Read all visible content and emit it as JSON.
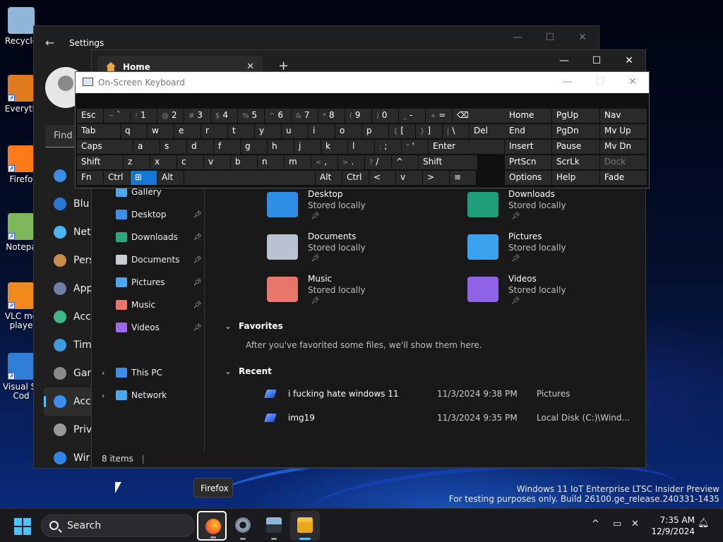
{
  "desktop": {
    "icons": [
      {
        "label": "Recycle"
      },
      {
        "label": "Everyth"
      },
      {
        "label": "Firefo"
      },
      {
        "label": "Notepa"
      },
      {
        "label": "VLC me\nplaye"
      },
      {
        "label": "Visual St\nCod"
      }
    ],
    "watermark_line1": "Windows 11 IoT Enterprise LTSC Insider Preview",
    "watermark_line2": "For testing purposes only. Build 26100.ge_release.240331-1435"
  },
  "settings": {
    "title": "Settings",
    "find_placeholder": "Find a",
    "nav": [
      {
        "label": "",
        "color": "#3a8ee6"
      },
      {
        "label": "Blu",
        "color": "#2a78d6"
      },
      {
        "label": "Net",
        "color": "#4cb4f0"
      },
      {
        "label": "Pers",
        "color": "#c98a4a"
      },
      {
        "label": "App",
        "color": "#6f7fa8"
      },
      {
        "label": "Acc",
        "color": "#3fb98a"
      },
      {
        "label": "Tim",
        "color": "#3c9be0"
      },
      {
        "label": "Gar",
        "color": "#8a8a8a"
      },
      {
        "label": "Acc",
        "color": "#3c8ef0",
        "active": true
      },
      {
        "label": "Priv",
        "color": "#9a9a9a"
      },
      {
        "label": "Wir",
        "color": "#2f86e8"
      }
    ]
  },
  "explorer": {
    "tab_label": "Home",
    "new_tab": "+",
    "sidebar": {
      "partial_top": "Gallery",
      "quick": [
        {
          "label": "Desktop",
          "color": "#3d8ee8"
        },
        {
          "label": "Downloads",
          "color": "#2ea87a"
        },
        {
          "label": "Documents",
          "color": "#c8ccd4"
        },
        {
          "label": "Pictures",
          "color": "#4aa8f0"
        },
        {
          "label": "Music",
          "color": "#e9756a"
        },
        {
          "label": "Videos",
          "color": "#9a6ae8"
        }
      ],
      "tree": [
        {
          "label": "This PC",
          "color": "#3d8ee8"
        },
        {
          "label": "Network",
          "color": "#4aa8f0"
        }
      ]
    },
    "folders": [
      {
        "name": "Desktop",
        "sub": "Stored locally",
        "color": "#2f8ee6"
      },
      {
        "name": "Downloads",
        "sub": "Stored locally",
        "color": "#1f9e7a"
      },
      {
        "name": "Documents",
        "sub": "Stored locally",
        "color": "#b9c2d0"
      },
      {
        "name": "Pictures",
        "sub": "Stored locally",
        "color": "#3aa2ee"
      },
      {
        "name": "Music",
        "sub": "Stored locally",
        "color": "#e7776a"
      },
      {
        "name": "Videos",
        "sub": "Stored locally",
        "color": "#8f63e6"
      }
    ],
    "favorites_header": "Favorites",
    "favorites_empty": "After you've favorited some files, we'll show them here.",
    "recent_header": "Recent",
    "recent": [
      {
        "name": "i fucking hate windows 11",
        "date": "11/3/2024 9:38 PM",
        "location": "Pictures"
      },
      {
        "name": "img19",
        "date": "11/3/2024 9:35 PM",
        "location": "Local Disk (C:)\\Wind..."
      }
    ],
    "status": "8 items"
  },
  "osk": {
    "title": "On-Screen Keyboard",
    "rows": [
      [
        {
          "label": "Esc"
        },
        {
          "sec": "~",
          "label": "`"
        },
        {
          "sec": "!",
          "label": "1"
        },
        {
          "sec": "@",
          "label": "2"
        },
        {
          "sec": "#",
          "label": "3"
        },
        {
          "sec": "$",
          "label": "4"
        },
        {
          "sec": "%",
          "label": "5"
        },
        {
          "sec": "^",
          "label": "6"
        },
        {
          "sec": "&",
          "label": "7"
        },
        {
          "sec": "*",
          "label": "8"
        },
        {
          "sec": "(",
          "label": "9"
        },
        {
          "sec": ")",
          "label": "0"
        },
        {
          "sec": "_",
          "label": "-"
        },
        {
          "sec": "+",
          "label": "="
        },
        {
          "label": "⌫"
        }
      ],
      [
        {
          "label": "Tab"
        },
        {
          "label": "q"
        },
        {
          "label": "w"
        },
        {
          "label": "e"
        },
        {
          "label": "r"
        },
        {
          "label": "t"
        },
        {
          "label": "y"
        },
        {
          "label": "u"
        },
        {
          "label": "i"
        },
        {
          "label": "o"
        },
        {
          "label": "p"
        },
        {
          "sec": "{",
          "label": "["
        },
        {
          "sec": "}",
          "label": "]"
        },
        {
          "sec": "|",
          "label": "\\"
        },
        {
          "label": "Del"
        }
      ],
      [
        {
          "label": "Caps"
        },
        {
          "label": "a"
        },
        {
          "label": "s"
        },
        {
          "label": "d"
        },
        {
          "label": "f"
        },
        {
          "label": "g"
        },
        {
          "label": "h"
        },
        {
          "label": "j"
        },
        {
          "label": "k"
        },
        {
          "label": "l"
        },
        {
          "sec": ":",
          "label": ";"
        },
        {
          "sec": "\"",
          "label": "'"
        },
        {
          "label": "Enter"
        }
      ],
      [
        {
          "label": "Shift"
        },
        {
          "label": "z"
        },
        {
          "label": "x"
        },
        {
          "label": "c"
        },
        {
          "label": "v"
        },
        {
          "label": "b"
        },
        {
          "label": "n"
        },
        {
          "label": "m"
        },
        {
          "sec": "<",
          "label": ","
        },
        {
          "sec": ">",
          "label": "."
        },
        {
          "sec": "?",
          "label": "/"
        },
        {
          "label": "^"
        },
        {
          "label": "Shift"
        }
      ],
      [
        {
          "label": "Fn"
        },
        {
          "label": "Ctrl"
        },
        {
          "label": "⊞",
          "blue": true
        },
        {
          "label": "Alt"
        },
        {
          "label": ""
        },
        {
          "label": "Alt"
        },
        {
          "label": "Ctrl"
        },
        {
          "label": "<"
        },
        {
          "label": "v"
        },
        {
          "label": ">"
        },
        {
          "label": "≡"
        }
      ]
    ],
    "nav_keys": [
      [
        "Home",
        "PgUp",
        "Nav"
      ],
      [
        "End",
        "PgDn",
        "Mv Up"
      ],
      [
        "Insert",
        "Pause",
        "Mv Dn"
      ],
      [
        "PrtScn",
        "ScrLk",
        "Dock"
      ],
      [
        "Options",
        "Help",
        "Fade"
      ]
    ]
  },
  "taskbar": {
    "search_label": "Search",
    "tooltip": "Firefox",
    "time": "7:35 AM",
    "date": "12/9/2024",
    "tray_chevron": "^"
  }
}
